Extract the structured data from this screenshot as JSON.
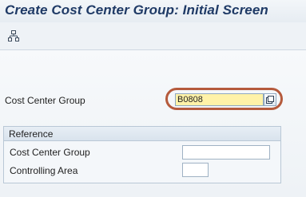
{
  "window": {
    "title": "Create Cost Center Group: Initial Screen"
  },
  "toolbar": {
    "hierarchy_icon": "hierarchy-icon"
  },
  "main": {
    "cost_center_group_label": "Cost Center Group",
    "cost_center_group_value": "B0808"
  },
  "reference": {
    "title": "Reference",
    "cost_center_group_label": "Cost Center Group",
    "cost_center_group_value": "",
    "controlling_area_label": "Controlling Area",
    "controlling_area_value": ""
  },
  "colors": {
    "title_text": "#1f3a66",
    "required_field_bg": "#fff2a8",
    "highlight_ring": "#b55a3c"
  }
}
